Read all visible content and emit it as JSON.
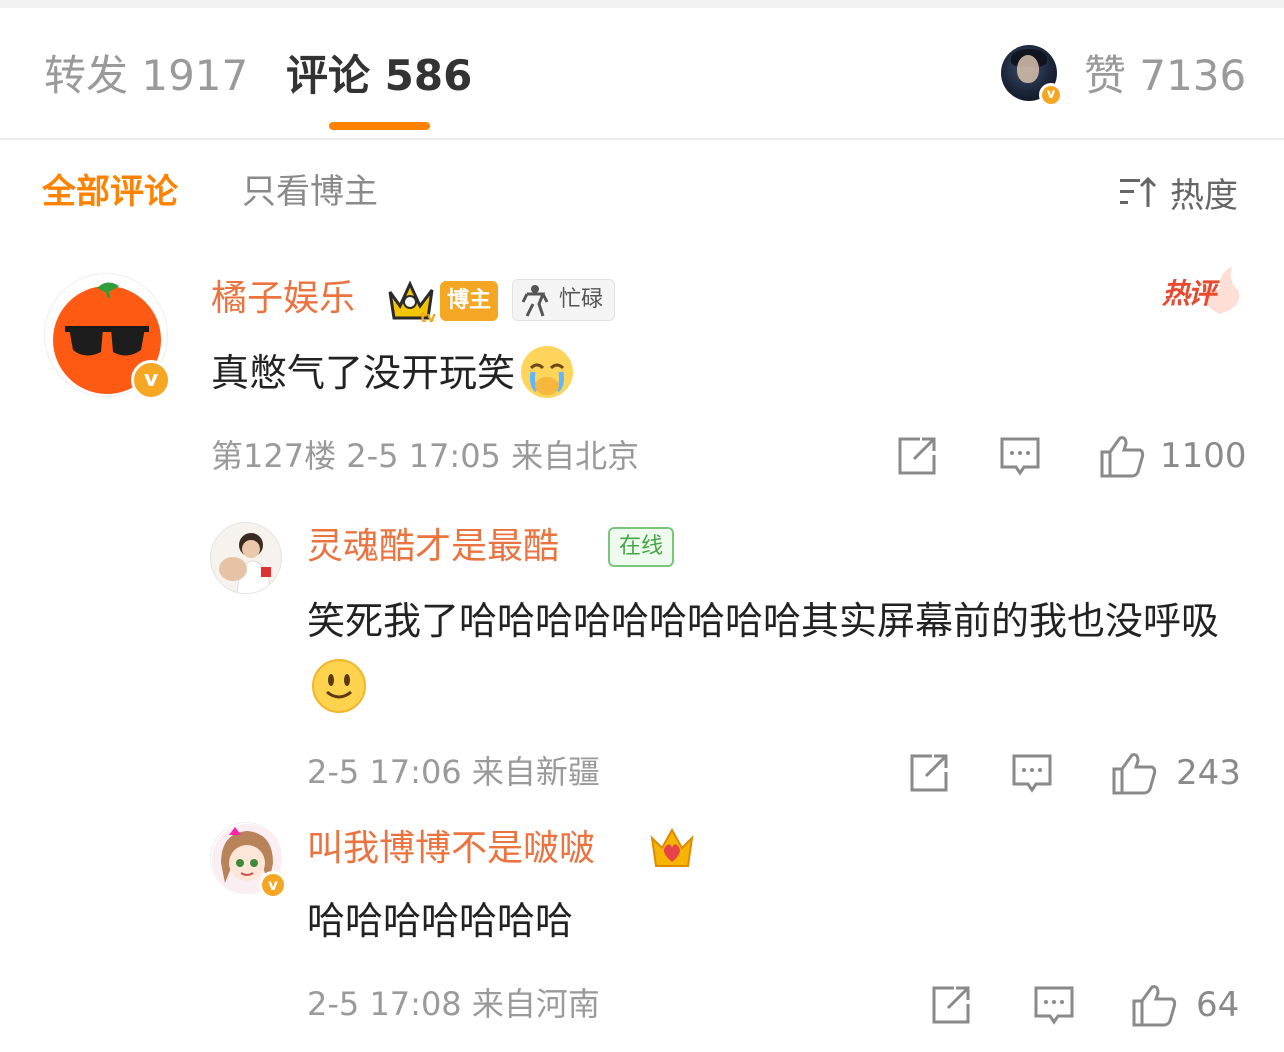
{
  "tabs": {
    "repost": "转发 1917",
    "comment": "评论 586",
    "like": "赞 7136"
  },
  "filters": {
    "all": "全部评论",
    "author_only": "只看博主",
    "sort": "热度"
  },
  "colors": {
    "accent": "#ff8200",
    "username": "#eb7340",
    "verified": "#f5a623",
    "online": "#45a644"
  },
  "comments": [
    {
      "user": "橘子娱乐",
      "tags": [
        "博主",
        "忙碌"
      ],
      "hot_label": "热评",
      "text": "真憋气了没开玩笑",
      "emoji": "crying-face-covering-mouth",
      "meta": "第127楼 2-5 17:05 来自北京",
      "likes": "1100",
      "replies": [
        {
          "user": "灵魂酷才是最酷",
          "tag": "在线",
          "text": "笑死我了哈哈哈哈哈哈哈哈哈其实屏幕前的我也没呼吸",
          "emoji": "smile-face",
          "meta": "2-5 17:06 来自新疆",
          "likes": "243"
        },
        {
          "user": "叫我博博不是啵啵",
          "badge": "crown-heart-icon",
          "text": "哈哈哈哈哈哈哈",
          "meta": "2-5 17:08 来自河南",
          "likes": "64"
        }
      ]
    }
  ]
}
